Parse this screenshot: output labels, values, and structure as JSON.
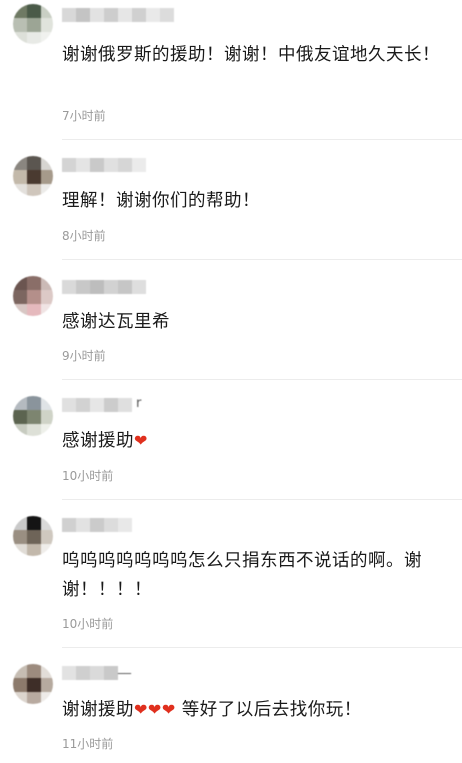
{
  "comments": [
    {
      "username_tail": "",
      "text": "谢谢俄罗斯的援助！谢谢！中俄友谊地久天长！",
      "time": "7小时前"
    },
    {
      "username_tail": "",
      "text": "理解！谢谢你们的帮助！",
      "time": "8小时前"
    },
    {
      "username_tail": "",
      "text": "感谢达瓦里希",
      "time": "9小时前"
    },
    {
      "username_tail": "r",
      "text": "感谢援助",
      "hearts": "❤",
      "time": "10小时前"
    },
    {
      "username_tail": "",
      "text": "呜呜呜呜呜呜呜怎么只捐东西不说话的啊。谢谢！！！！",
      "time": "10小时前"
    },
    {
      "username_tail": "__",
      "text": "谢谢援助",
      "hearts": "❤❤❤",
      "text_after": " 等好了以后去找你玩！",
      "time": "11小时前"
    }
  ],
  "colors": {
    "heart": "#e0301e",
    "time": "#9a9a9a",
    "divider": "#ececec"
  }
}
